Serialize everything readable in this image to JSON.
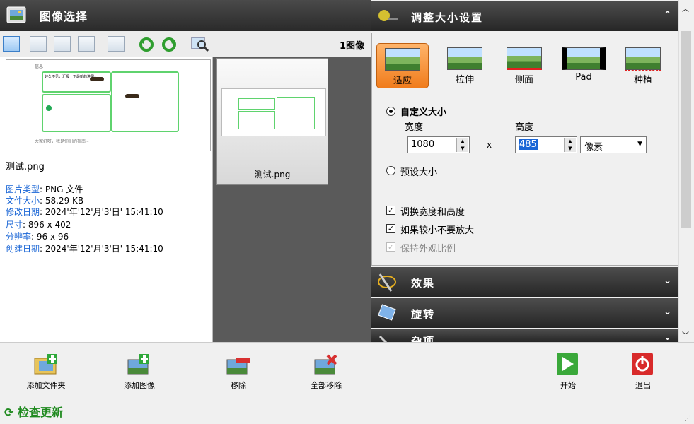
{
  "left": {
    "title": "图像选择",
    "count": "1图像",
    "file_name": "测试.png",
    "gallery_caption": "测试.png",
    "meta": [
      {
        "k": "图片类型",
        "v": ": PNG 文件"
      },
      {
        "k": "文件大小",
        "v": ": 58.29 KB"
      },
      {
        "k": "修改日期",
        "v": ": 2024'年'12'月'3'日' 15:41:10"
      },
      {
        "k": "尺寸",
        "v": ": 896 x 402"
      },
      {
        "k": "分辨率",
        "v": ": 96 x 96"
      },
      {
        "k": "创建日期",
        "v": ": 2024'年'12'月'3'日' 15:41:10"
      }
    ],
    "thumb_text": {
      "top": "信息",
      "line1": "好久不见，汇报一下最新的进展。",
      "footer": "大家好呀，我是你们的指南~"
    }
  },
  "right": {
    "resize_title": "调整大小设置",
    "modes": [
      "适应",
      "拉伸",
      "侧面",
      "Pad",
      "种植"
    ],
    "custom_size": "自定义大小",
    "width_label": "宽度",
    "height_label": "高度",
    "width_value": "1080",
    "x_sep": "x",
    "height_value": "485",
    "unit": "像素",
    "preset_size": "预设大小",
    "swap": "调换宽度和高度",
    "no_enlarge": "如果较小不要放大",
    "keep_ratio": "保持外观比例",
    "effects": "效果",
    "rotate": "旋转",
    "misc": "杂项"
  },
  "bottom": {
    "add_folder": "添加文件夹",
    "add_image": "添加图像",
    "remove": "移除",
    "remove_all": "全部移除",
    "start": "开始",
    "exit": "退出",
    "check_update": "检查更新"
  }
}
